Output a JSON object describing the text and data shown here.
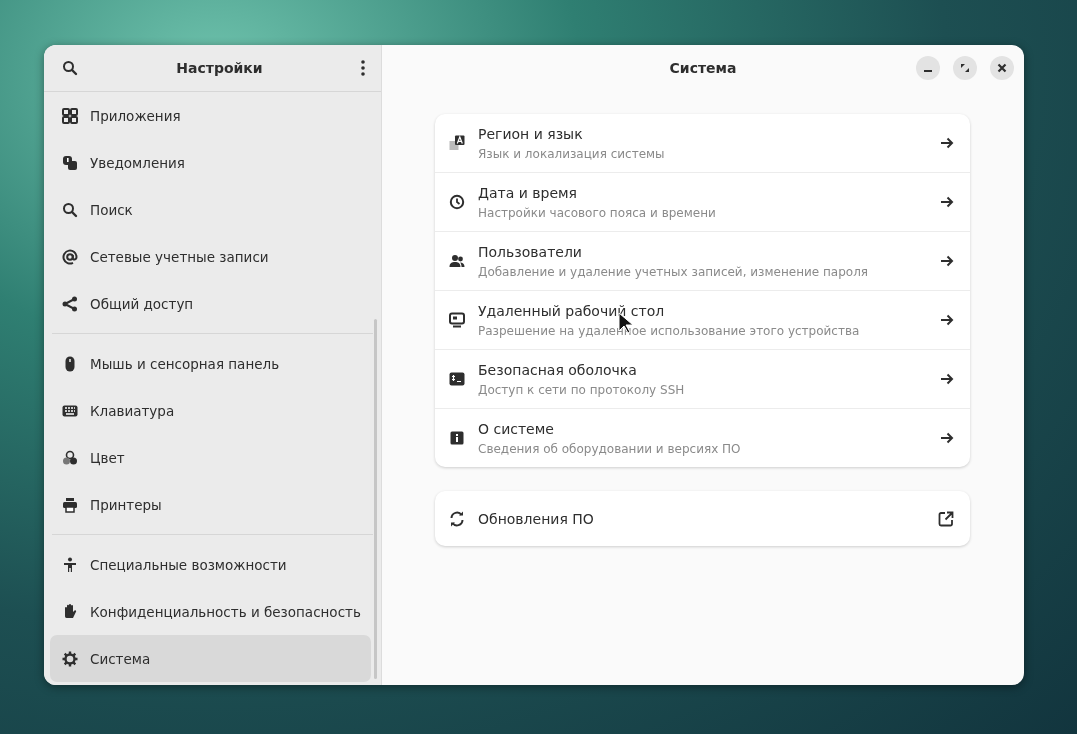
{
  "sidebar": {
    "title": "Настройки",
    "groups": [
      [
        {
          "label": "Приложения",
          "selected": false
        },
        {
          "label": "Уведомления",
          "selected": false
        },
        {
          "label": "Поиск",
          "selected": false
        },
        {
          "label": "Сетевые учетные записи",
          "selected": false
        },
        {
          "label": "Общий доступ",
          "selected": false
        }
      ],
      [
        {
          "label": "Мышь и сенсорная панель",
          "selected": false
        },
        {
          "label": "Клавиатура",
          "selected": false
        },
        {
          "label": "Цвет",
          "selected": false
        },
        {
          "label": "Принтеры",
          "selected": false
        }
      ],
      [
        {
          "label": "Специальные возможности",
          "selected": false
        },
        {
          "label": "Конфиденциальность и безопасность",
          "selected": false
        },
        {
          "label": "Система",
          "selected": true
        }
      ]
    ]
  },
  "main": {
    "title": "Система",
    "rows": [
      {
        "title": "Регион и язык",
        "subtitle": "Язык и локализация системы"
      },
      {
        "title": "Дата и время",
        "subtitle": "Настройки часового пояса и времени"
      },
      {
        "title": "Пользователи",
        "subtitle": "Добавление и удаление учетных записей, изменение пароля"
      },
      {
        "title": "Удаленный рабочий стол",
        "subtitle": "Разрешение на удаленное использование этого устройства"
      },
      {
        "title": "Безопасная оболочка",
        "subtitle": "Доступ к сети по протоколу SSH"
      },
      {
        "title": "О системе",
        "subtitle": "Сведения об оборудовании и версиях ПО"
      }
    ],
    "external": {
      "title": "Обновления ПО"
    }
  }
}
